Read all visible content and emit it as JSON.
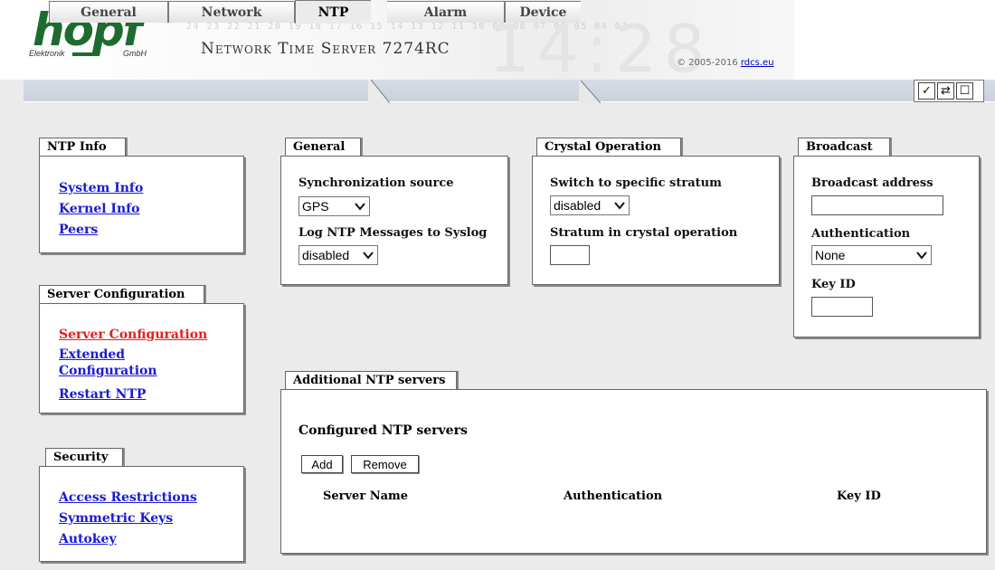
{
  "header": {
    "logo_word": "hopf",
    "logo_left": "Elektronik",
    "logo_right": "GmbH",
    "digits": "24 23 22 21 20 19 18 17 16 15 14 13 12 11 10 09 08 07 06 05 04 01",
    "product_title": "Network Time Server 7274RC",
    "copyright_prefix": "© 2005-2016 ",
    "copyright_link": "rdcs.eu"
  },
  "tabs": [
    {
      "label": "General",
      "active": false
    },
    {
      "label": "Network",
      "active": false
    },
    {
      "label": "NTP",
      "active": true
    },
    {
      "label": "Alarm",
      "active": false
    },
    {
      "label": "Device",
      "active": false
    }
  ],
  "toolbar": {
    "tools": [
      {
        "icon": "check-icon",
        "glyph": "✓"
      },
      {
        "icon": "refresh-icon",
        "glyph": "⇄"
      },
      {
        "icon": "window-icon",
        "glyph": "☐"
      }
    ]
  },
  "ntp_info": {
    "title": "NTP Info",
    "links": [
      "System Info",
      "Kernel Info",
      "Peers"
    ]
  },
  "server_configuration": {
    "title": "Server Configuration",
    "links": [
      "Server Configuration",
      "Extended Configuration",
      "Restart NTP"
    ],
    "current_index": 0
  },
  "security": {
    "title": "Security",
    "links": [
      "Access Restrictions",
      "Symmetric Keys",
      "Autokey"
    ]
  },
  "general": {
    "title": "General",
    "sync_source_label": "Synchronization source",
    "sync_source_value": "GPS",
    "log_label": "Log NTP Messages to Syslog",
    "log_value": "disabled"
  },
  "crystal": {
    "title": "Crystal Operation",
    "switch_label": "Switch to specific stratum",
    "switch_value": "disabled",
    "stratum_label": "Stratum in crystal operation",
    "stratum_value": ""
  },
  "broadcast": {
    "title": "Broadcast",
    "address_label": "Broadcast address",
    "address_value": "",
    "auth_label": "Authentication",
    "auth_value": "None",
    "keyid_label": "Key ID",
    "keyid_value": ""
  },
  "additional": {
    "title": "Additional NTP servers",
    "subheading": "Configured NTP servers",
    "add_label": "Add",
    "remove_label": "Remove",
    "columns": [
      "Server Name",
      "Authentication",
      "Key ID"
    ]
  }
}
